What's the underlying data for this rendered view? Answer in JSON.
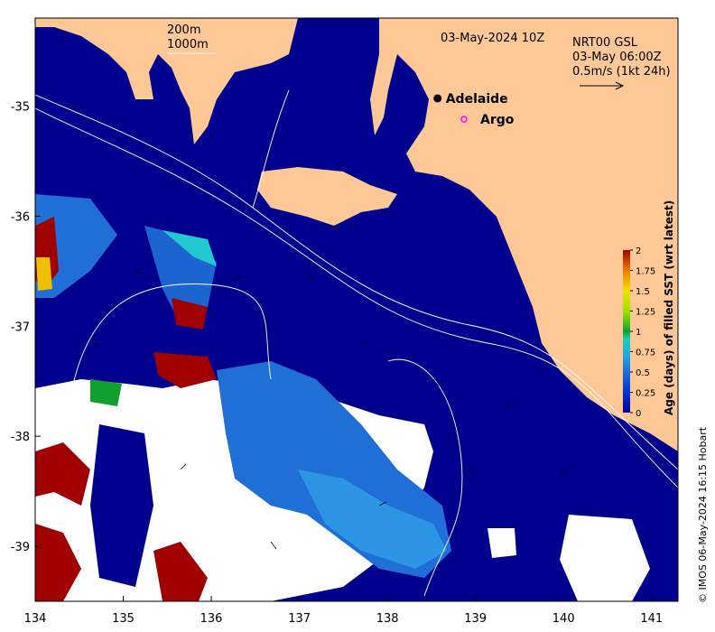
{
  "map": {
    "timestamp": "03-May-2024 10Z",
    "depth_labels": [
      "200m",
      "1000m"
    ],
    "current_info": [
      "NRT00 GSL",
      "03-May 06:00Z",
      "0.5m/s (1kt 24h)"
    ],
    "places": [
      {
        "name": "Adelaide",
        "lon": 138.57,
        "lat": -34.93,
        "marker": "dot"
      },
      {
        "name": "Argo",
        "lon": 138.87,
        "lat": -35.12,
        "marker": "ring"
      }
    ],
    "xaxis": {
      "ticks": [
        134,
        135,
        136,
        137,
        138,
        139,
        140,
        141
      ],
      "range": [
        134,
        141.3
      ]
    },
    "yaxis": {
      "ticks": [
        -35,
        -36,
        -37,
        -38,
        -39
      ],
      "range": [
        -39.5,
        -34.2
      ]
    },
    "credit": "© IMOS 06-May-2024 16:15 Hobart"
  },
  "colorbar": {
    "title": "Age (days) of filled SST (wrt latest)",
    "ticks": [
      "0",
      "0.25",
      "0.5",
      "0.75",
      "1",
      "1.25",
      "1.5",
      "1.75",
      "2"
    ],
    "range": [
      0,
      2
    ]
  },
  "colors": {
    "ocean": "#00008f",
    "land": "#fdc896",
    "nodata": "#ffffff",
    "recent": "#1f6fd6",
    "old": "#a00000",
    "contour": "#ffffff",
    "argo": "#ff00ff"
  }
}
